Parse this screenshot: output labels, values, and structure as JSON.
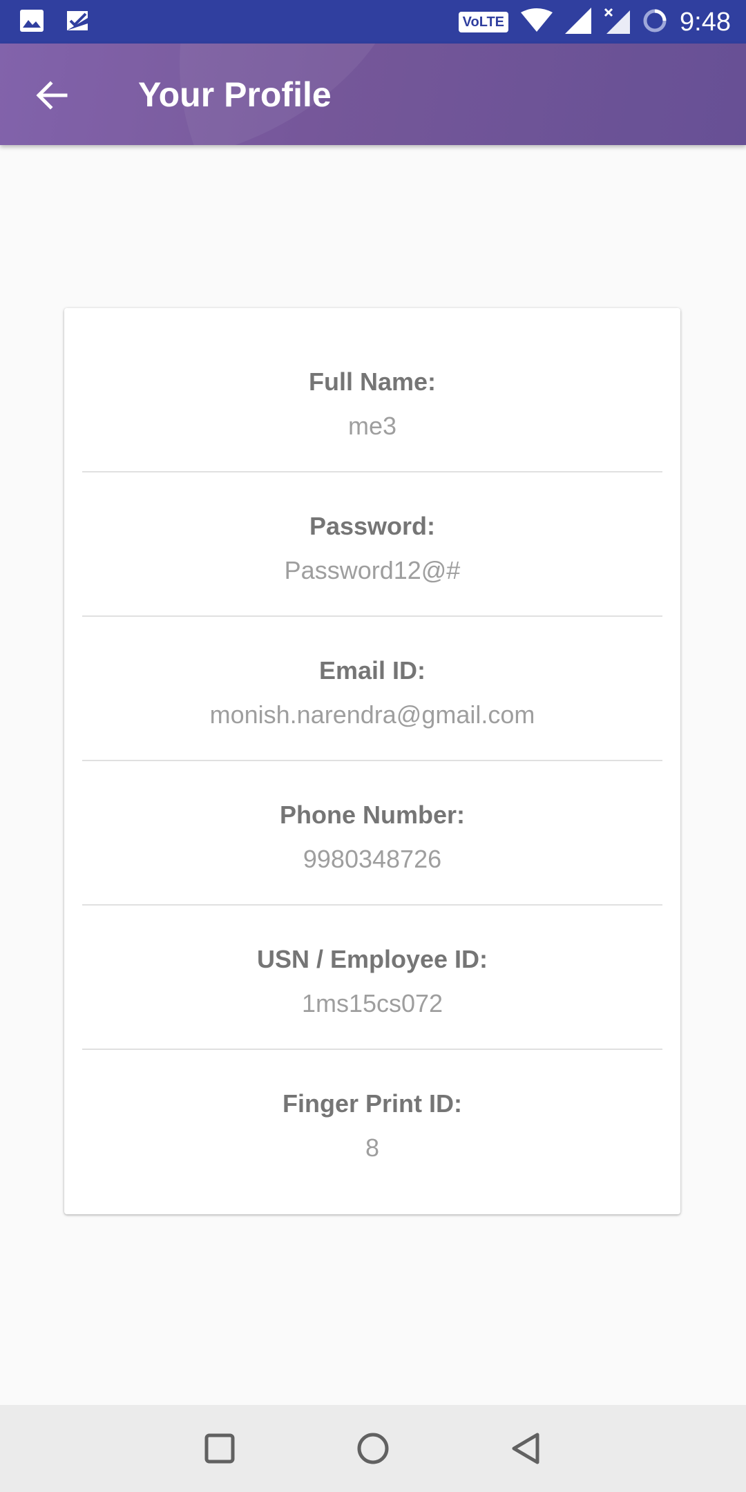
{
  "status_bar": {
    "time": "9:48",
    "volte_label": "VoLTE",
    "icons": [
      "gallery-icon",
      "checklist-icon",
      "wifi-icon",
      "signal-icon",
      "signal-x-icon",
      "sync-icon"
    ]
  },
  "app_bar": {
    "title": "Your Profile",
    "back_icon": "arrow-left-icon",
    "colors": {
      "start": "#7b5aa6",
      "end": "#5f4790"
    }
  },
  "profile": {
    "fields": [
      {
        "label": "Full Name:",
        "value": "me3"
      },
      {
        "label": "Password:",
        "value": "Password12@#"
      },
      {
        "label": "Email ID:",
        "value": "monish.narendra@gmail.com"
      },
      {
        "label": "Phone Number:",
        "value": "9980348726"
      },
      {
        "label": "USN / Employee ID:",
        "value": "1ms15cs072"
      },
      {
        "label": "Finger Print ID:",
        "value": "8"
      }
    ]
  },
  "nav_bar": {
    "buttons": [
      "recents-square-icon",
      "home-circle-icon",
      "back-triangle-icon"
    ]
  }
}
